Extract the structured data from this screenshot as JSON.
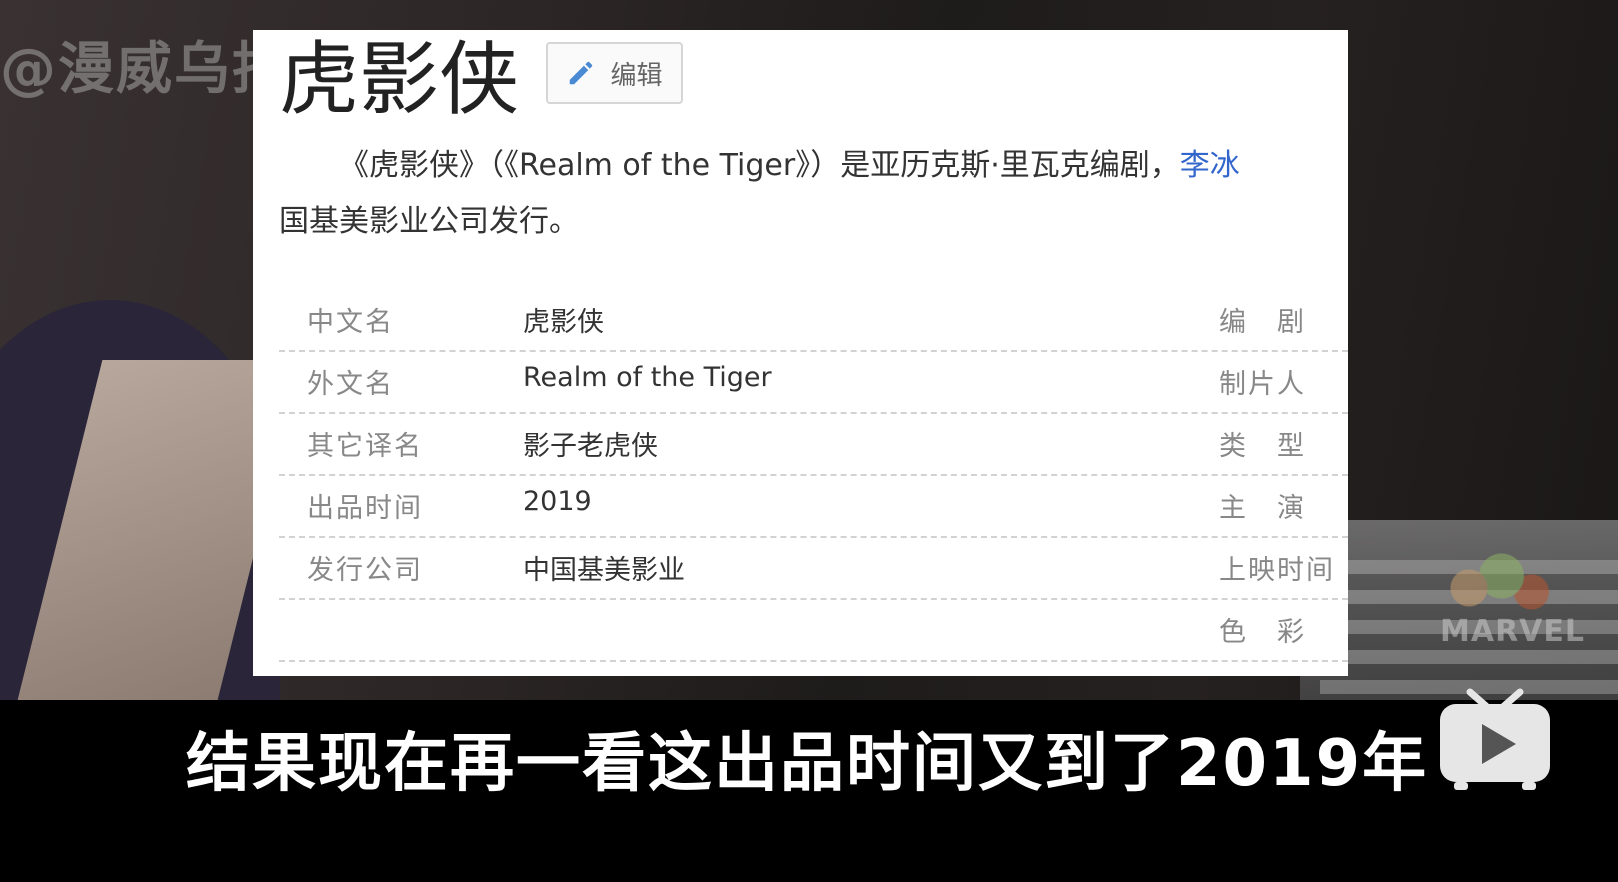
{
  "watermark": {
    "text": "@漫威乌托"
  },
  "brand_badge": {
    "text": "MARVEL"
  },
  "entry": {
    "title": "虎影侠",
    "edit_label": "编辑",
    "summary_prefix": "《虎影侠》（《Realm of the Tiger》）是亚历克斯·里瓦克编剧，",
    "summary_link": "李冰",
    "summary_line2": "国基美影业公司发行。"
  },
  "info_rows": [
    {
      "key": "中文名",
      "value": "虎影侠",
      "right_key": "编　剧"
    },
    {
      "key": "外文名",
      "value": "Realm of the Tiger",
      "right_key": "制片人"
    },
    {
      "key": "其它译名",
      "value": "影子老虎侠",
      "right_key": "类　型"
    },
    {
      "key": "出品时间",
      "value": "2019",
      "right_key": "主　演"
    },
    {
      "key": "发行公司",
      "value": "中国基美影业",
      "right_key": "上映时间"
    },
    {
      "key": "",
      "value": "",
      "right_key": "色　彩"
    }
  ],
  "subtitle": {
    "text": "结果现在再一看这出品时间又到了2019年"
  },
  "colors": {
    "link": "#3366cc",
    "card_bg": "#ffffff",
    "subtitle": "#ffffff"
  }
}
